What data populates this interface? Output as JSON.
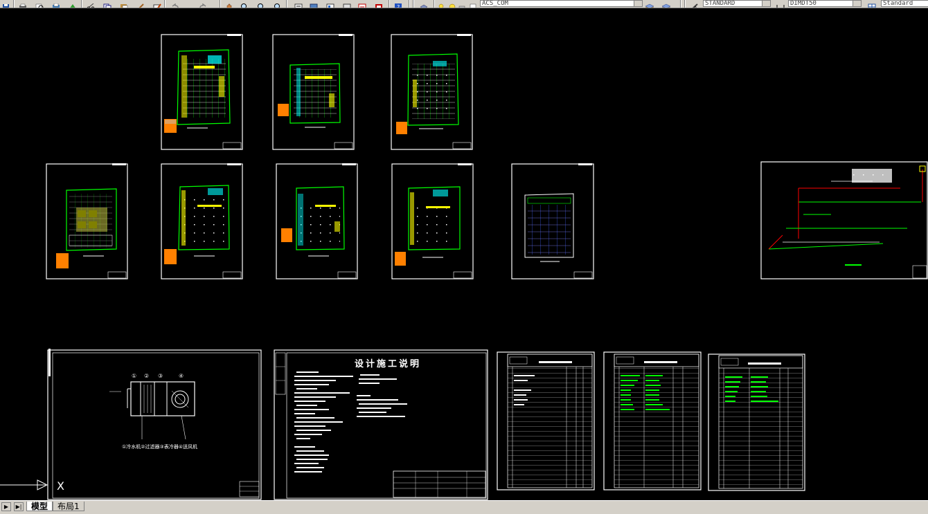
{
  "toolbar": {
    "layer_combo": "ACS_COM",
    "text_style": "STANDARD",
    "dim_style": "DIMDT50",
    "table_style": "Standard"
  },
  "canvas": {
    "background": "#000000",
    "drawing_title": "设计施工说明",
    "equipment_label": "①冷水机②过滤器③表冷器④送风机",
    "circle_numbers": [
      "①",
      "②",
      "③",
      "④"
    ],
    "ucs_label": "X"
  },
  "tabs": [
    {
      "label": "模型",
      "active": true
    },
    {
      "label": "布局1",
      "active": false
    }
  ],
  "colors": {
    "green": "#00ff00",
    "yellow": "#ffff00",
    "cyan": "#00ffff",
    "white": "#ffffff",
    "red": "#ff0000",
    "orange": "#ff8000",
    "blue": "#0000ff",
    "magenta": "#ff00ff"
  }
}
